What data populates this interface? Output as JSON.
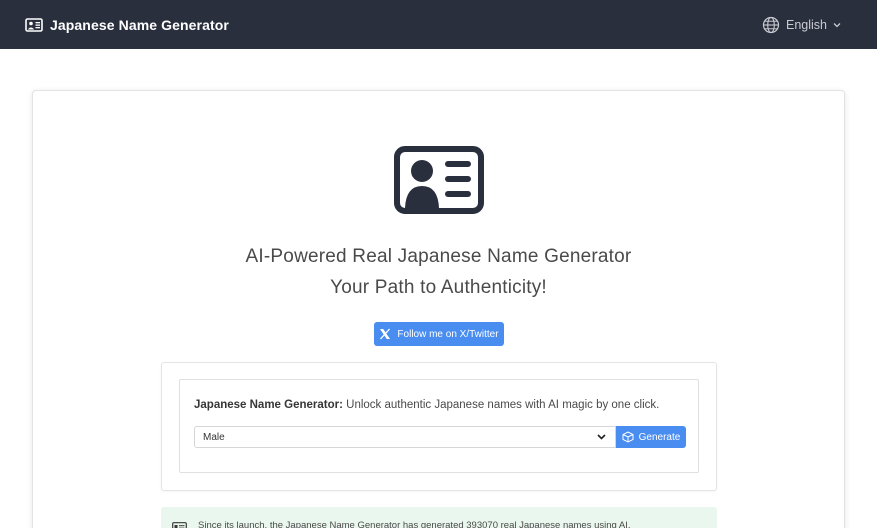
{
  "navbar": {
    "brand": "Japanese Name Generator",
    "language": "English"
  },
  "hero": {
    "title_line1": "AI-Powered Real Japanese Name Generator",
    "title_line2": "Your Path to Authenticity!",
    "twitter_button": "Follow me on X/Twitter"
  },
  "generator": {
    "label_bold": "Japanese Name Generator:",
    "label_rest": " Unlock authentic Japanese names with AI magic by one click.",
    "gender_selected": "Male",
    "generate_button": "Generate"
  },
  "notice": {
    "text": "Since its launch, the Japanese Name Generator has generated 393070 real Japanese names using AI."
  },
  "colors": {
    "navbar_bg": "#2a2f3d",
    "primary": "#4a8df0",
    "notice_bg": "#eaf7ee"
  }
}
